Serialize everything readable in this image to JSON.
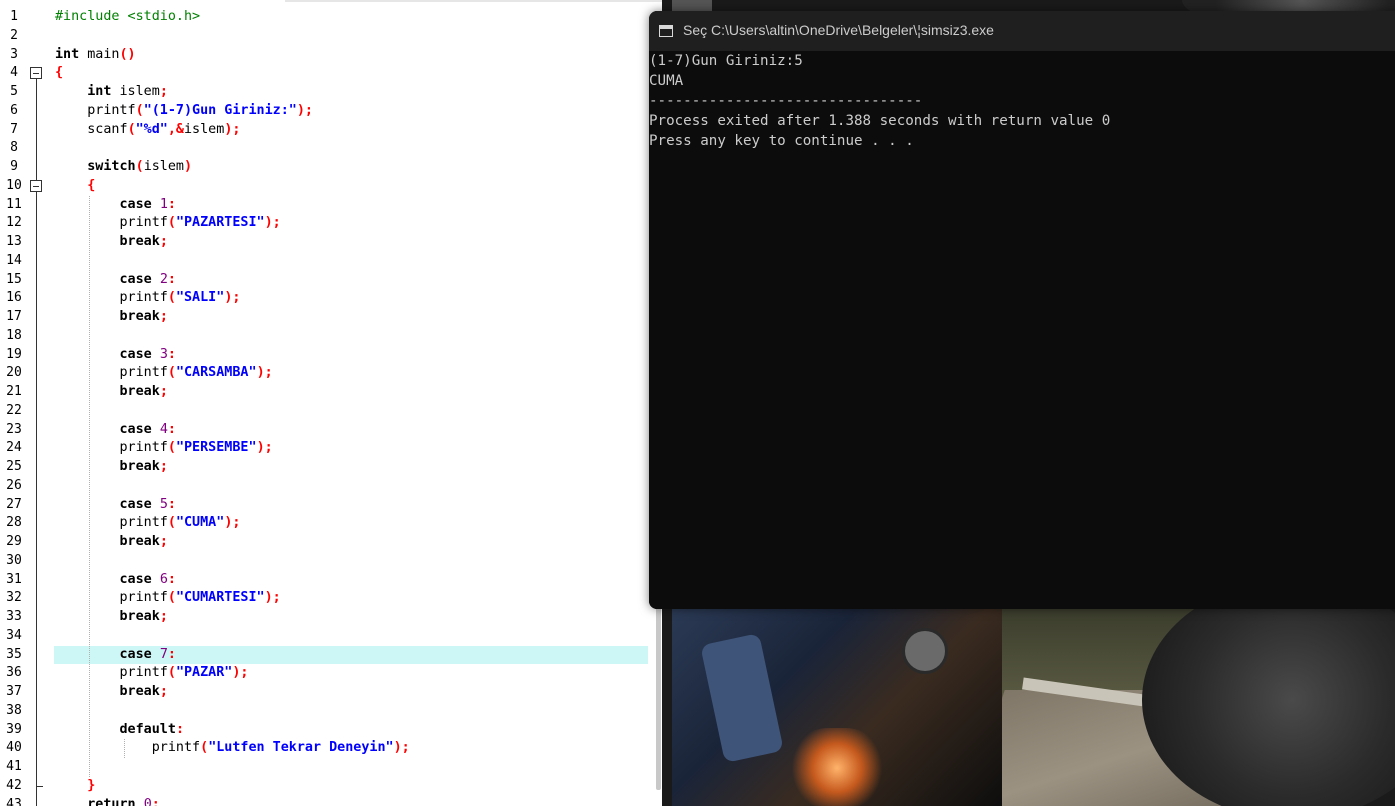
{
  "editor": {
    "lines": [
      {
        "n": "1",
        "tokens": [
          [
            "pp",
            "#include <stdio.h>"
          ]
        ]
      },
      {
        "n": "2",
        "tokens": []
      },
      {
        "n": "3",
        "tokens": [
          [
            "kw",
            "int"
          ],
          [
            "fn",
            " main"
          ],
          [
            "sym",
            "()"
          ]
        ]
      },
      {
        "n": "4",
        "tokens": [
          [
            "sym",
            "{"
          ]
        ]
      },
      {
        "n": "5",
        "tokens": [
          [
            "fn",
            "    "
          ],
          [
            "kw",
            "int"
          ],
          [
            "fn",
            " islem"
          ],
          [
            "sym",
            ";"
          ]
        ]
      },
      {
        "n": "6",
        "tokens": [
          [
            "fn",
            "    printf"
          ],
          [
            "sym",
            "("
          ],
          [
            "str",
            "\"(1-7)Gun Giriniz:\""
          ],
          [
            "sym",
            ");"
          ]
        ]
      },
      {
        "n": "7",
        "tokens": [
          [
            "fn",
            "    scanf"
          ],
          [
            "sym",
            "("
          ],
          [
            "str",
            "\"%d\""
          ],
          [
            "sym",
            ",&"
          ],
          [
            "fn",
            "islem"
          ],
          [
            "sym",
            ");"
          ]
        ]
      },
      {
        "n": "8",
        "tokens": []
      },
      {
        "n": "9",
        "tokens": [
          [
            "fn",
            "    "
          ],
          [
            "kw",
            "switch"
          ],
          [
            "sym",
            "("
          ],
          [
            "fn",
            "islem"
          ],
          [
            "sym",
            ")"
          ]
        ]
      },
      {
        "n": "10",
        "tokens": [
          [
            "fn",
            "    "
          ],
          [
            "sym",
            "{"
          ]
        ]
      },
      {
        "n": "11",
        "tokens": [
          [
            "fn",
            "        "
          ],
          [
            "kw",
            "case"
          ],
          [
            "fn",
            " "
          ],
          [
            "num",
            "1"
          ],
          [
            "sym",
            ":"
          ]
        ]
      },
      {
        "n": "12",
        "tokens": [
          [
            "fn",
            "        printf"
          ],
          [
            "sym",
            "("
          ],
          [
            "str",
            "\"PAZARTESI\""
          ],
          [
            "sym",
            ");"
          ]
        ]
      },
      {
        "n": "13",
        "tokens": [
          [
            "fn",
            "        "
          ],
          [
            "kw",
            "break"
          ],
          [
            "sym",
            ";"
          ]
        ]
      },
      {
        "n": "14",
        "tokens": []
      },
      {
        "n": "15",
        "tokens": [
          [
            "fn",
            "        "
          ],
          [
            "kw",
            "case"
          ],
          [
            "fn",
            " "
          ],
          [
            "num",
            "2"
          ],
          [
            "sym",
            ":"
          ]
        ]
      },
      {
        "n": "16",
        "tokens": [
          [
            "fn",
            "        printf"
          ],
          [
            "sym",
            "("
          ],
          [
            "str",
            "\"SALI\""
          ],
          [
            "sym",
            ");"
          ]
        ]
      },
      {
        "n": "17",
        "tokens": [
          [
            "fn",
            "        "
          ],
          [
            "kw",
            "break"
          ],
          [
            "sym",
            ";"
          ]
        ]
      },
      {
        "n": "18",
        "tokens": []
      },
      {
        "n": "19",
        "tokens": [
          [
            "fn",
            "        "
          ],
          [
            "kw",
            "case"
          ],
          [
            "fn",
            " "
          ],
          [
            "num",
            "3"
          ],
          [
            "sym",
            ":"
          ]
        ]
      },
      {
        "n": "20",
        "tokens": [
          [
            "fn",
            "        printf"
          ],
          [
            "sym",
            "("
          ],
          [
            "str",
            "\"CARSAMBA\""
          ],
          [
            "sym",
            ");"
          ]
        ]
      },
      {
        "n": "21",
        "tokens": [
          [
            "fn",
            "        "
          ],
          [
            "kw",
            "break"
          ],
          [
            "sym",
            ";"
          ]
        ]
      },
      {
        "n": "22",
        "tokens": []
      },
      {
        "n": "23",
        "tokens": [
          [
            "fn",
            "        "
          ],
          [
            "kw",
            "case"
          ],
          [
            "fn",
            " "
          ],
          [
            "num",
            "4"
          ],
          [
            "sym",
            ":"
          ]
        ]
      },
      {
        "n": "24",
        "tokens": [
          [
            "fn",
            "        printf"
          ],
          [
            "sym",
            "("
          ],
          [
            "str",
            "\"PERSEMBE\""
          ],
          [
            "sym",
            ");"
          ]
        ]
      },
      {
        "n": "25",
        "tokens": [
          [
            "fn",
            "        "
          ],
          [
            "kw",
            "break"
          ],
          [
            "sym",
            ";"
          ]
        ]
      },
      {
        "n": "26",
        "tokens": []
      },
      {
        "n": "27",
        "tokens": [
          [
            "fn",
            "        "
          ],
          [
            "kw",
            "case"
          ],
          [
            "fn",
            " "
          ],
          [
            "num",
            "5"
          ],
          [
            "sym",
            ":"
          ]
        ]
      },
      {
        "n": "28",
        "tokens": [
          [
            "fn",
            "        printf"
          ],
          [
            "sym",
            "("
          ],
          [
            "str",
            "\"CUMA\""
          ],
          [
            "sym",
            ");"
          ]
        ]
      },
      {
        "n": "29",
        "tokens": [
          [
            "fn",
            "        "
          ],
          [
            "kw",
            "break"
          ],
          [
            "sym",
            ";"
          ]
        ]
      },
      {
        "n": "30",
        "tokens": []
      },
      {
        "n": "31",
        "tokens": [
          [
            "fn",
            "        "
          ],
          [
            "kw",
            "case"
          ],
          [
            "fn",
            " "
          ],
          [
            "num",
            "6"
          ],
          [
            "sym",
            ":"
          ]
        ]
      },
      {
        "n": "32",
        "tokens": [
          [
            "fn",
            "        printf"
          ],
          [
            "sym",
            "("
          ],
          [
            "str",
            "\"CUMARTESI\""
          ],
          [
            "sym",
            ");"
          ]
        ]
      },
      {
        "n": "33",
        "tokens": [
          [
            "fn",
            "        "
          ],
          [
            "kw",
            "break"
          ],
          [
            "sym",
            ";"
          ]
        ]
      },
      {
        "n": "34",
        "tokens": []
      },
      {
        "n": "35",
        "tokens": [
          [
            "fn",
            "        "
          ],
          [
            "kw",
            "case"
          ],
          [
            "fn",
            " "
          ],
          [
            "num",
            "7"
          ],
          [
            "sym",
            ":"
          ]
        ],
        "highlight": true
      },
      {
        "n": "36",
        "tokens": [
          [
            "fn",
            "        printf"
          ],
          [
            "sym",
            "("
          ],
          [
            "str",
            "\"PAZAR\""
          ],
          [
            "sym",
            ");"
          ]
        ]
      },
      {
        "n": "37",
        "tokens": [
          [
            "fn",
            "        "
          ],
          [
            "kw",
            "break"
          ],
          [
            "sym",
            ";"
          ]
        ]
      },
      {
        "n": "38",
        "tokens": []
      },
      {
        "n": "39",
        "tokens": [
          [
            "fn",
            "        "
          ],
          [
            "kw",
            "default"
          ],
          [
            "sym",
            ":"
          ]
        ]
      },
      {
        "n": "40",
        "tokens": [
          [
            "fn",
            "            printf"
          ],
          [
            "sym",
            "("
          ],
          [
            "str",
            "\"Lutfen Tekrar Deneyin\""
          ],
          [
            "sym",
            ");"
          ]
        ]
      },
      {
        "n": "41",
        "tokens": []
      },
      {
        "n": "42",
        "tokens": [
          [
            "fn",
            "    "
          ],
          [
            "sym",
            "}"
          ]
        ]
      },
      {
        "n": "43",
        "tokens": [
          [
            "fn",
            "    "
          ],
          [
            "kw",
            "return"
          ],
          [
            "fn",
            " "
          ],
          [
            "num",
            "0"
          ],
          [
            "sym",
            ";"
          ]
        ]
      }
    ]
  },
  "console": {
    "title": "Seç C:\\Users\\altin\\OneDrive\\Belgeler\\¦simsiz3.exe",
    "output": [
      "(1-7)Gun Giriniz:5",
      "CUMA",
      "--------------------------------",
      "Process exited after 1.388 seconds with return value 0",
      "Press any key to continue . . ."
    ]
  },
  "colors": {
    "keyword": "#000000",
    "preprocessor": "#008000",
    "string": "#0000ff",
    "number": "#800080",
    "symbol": "#ff0000",
    "current_line": "#ccf7f7",
    "console_bg": "#0c0c0c",
    "console_text": "#cccccc"
  }
}
